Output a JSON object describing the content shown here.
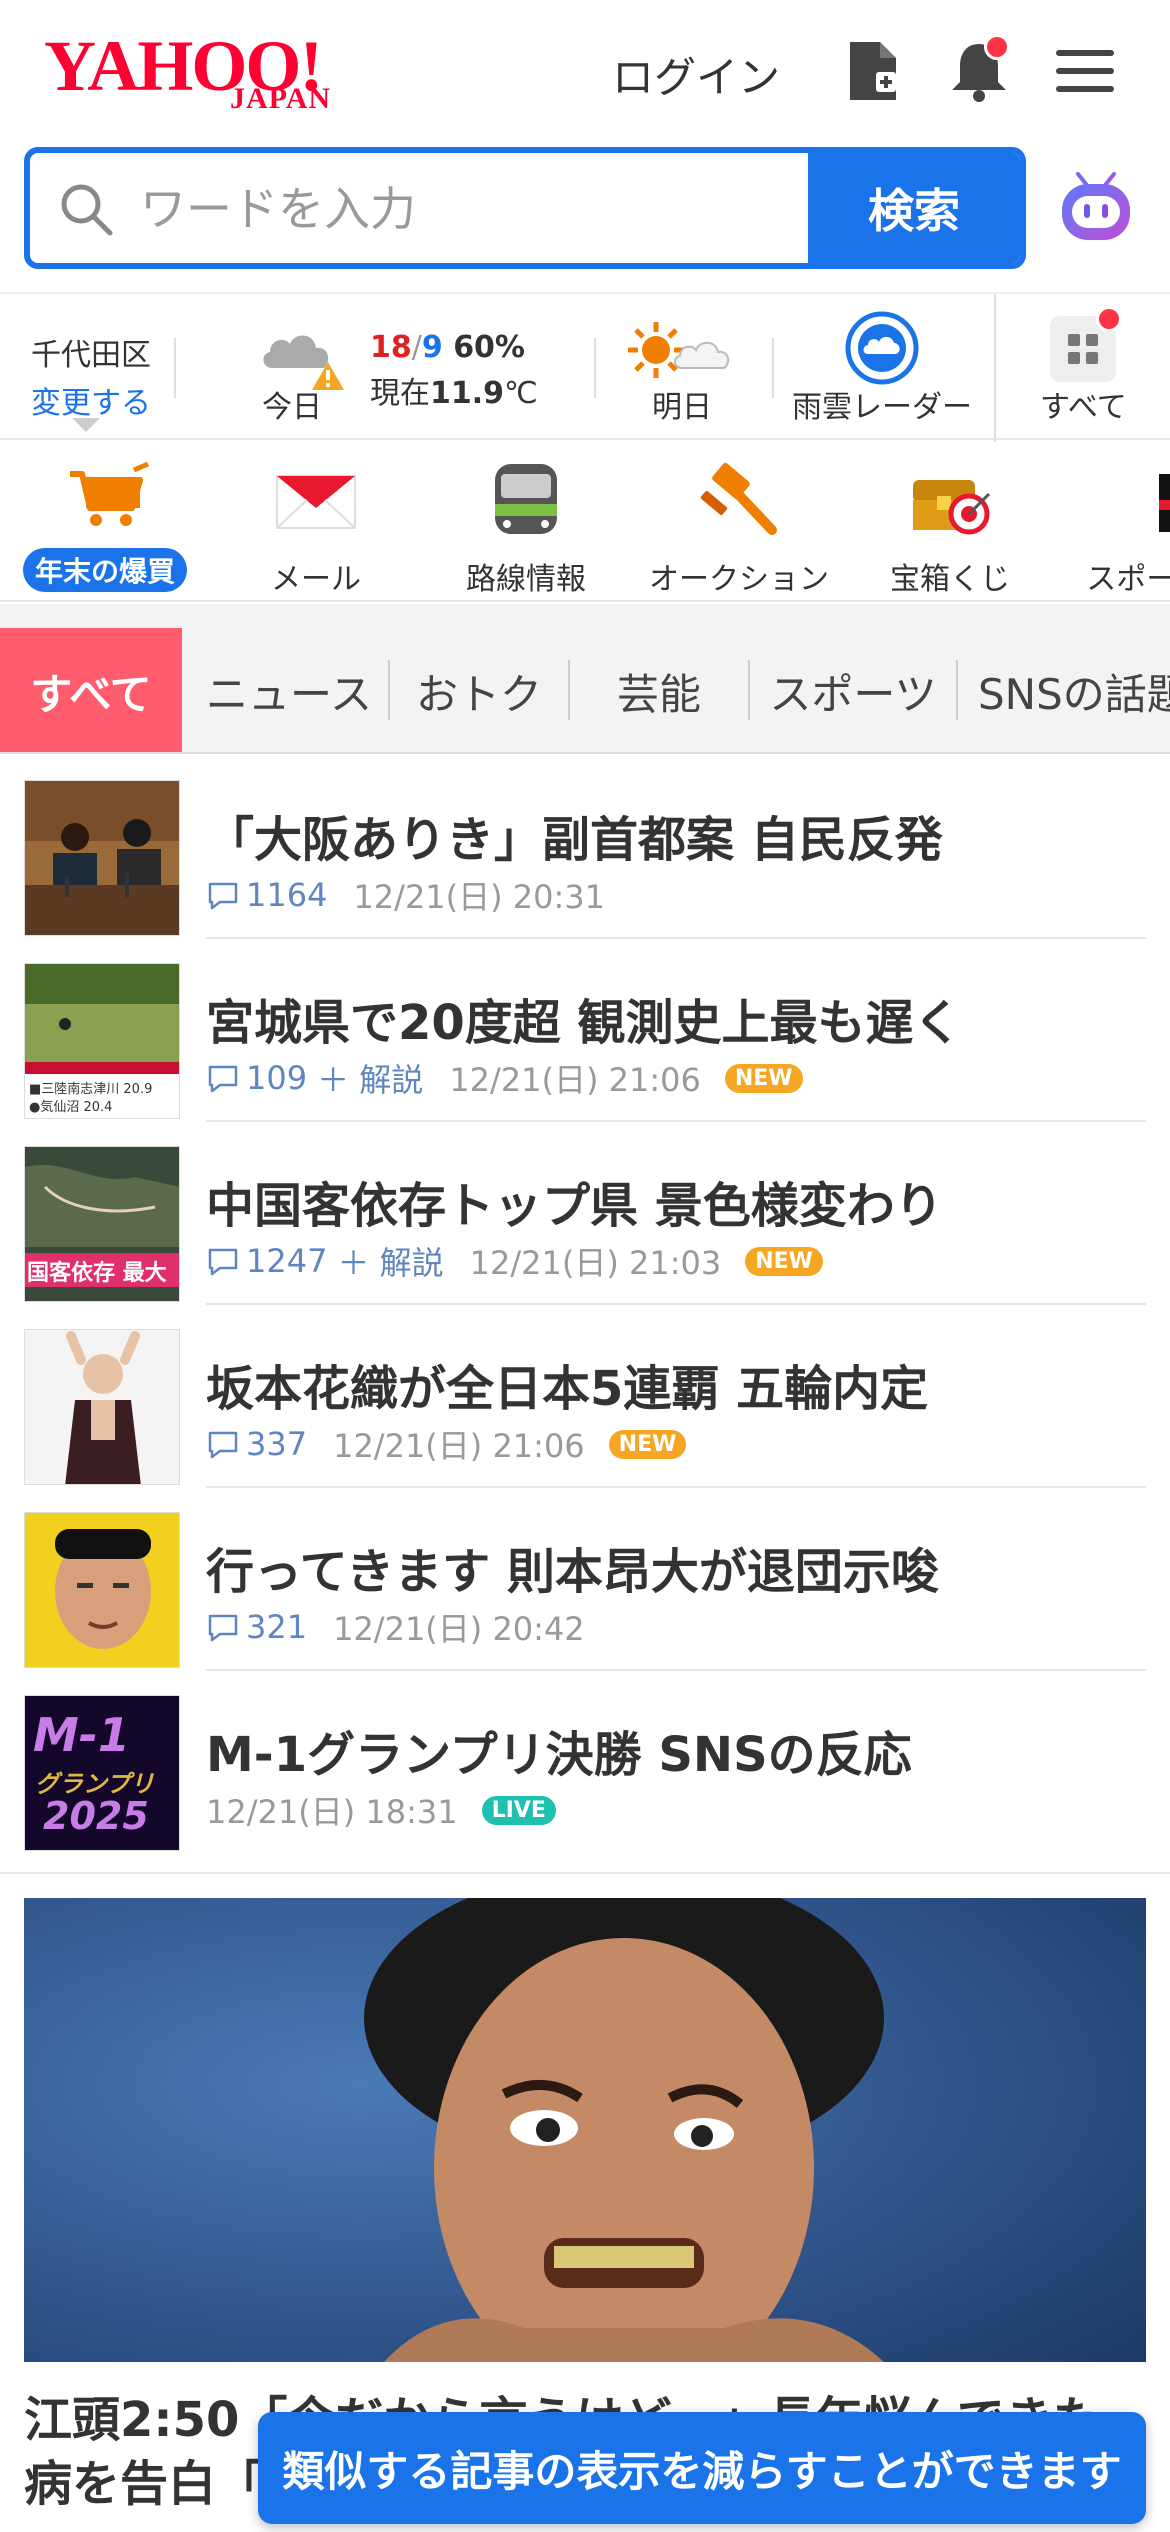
{
  "header": {
    "logo_main": "YAHOO!",
    "logo_sub": "JAPAN",
    "login_label": "ログイン"
  },
  "search": {
    "placeholder": "ワードを入力",
    "button_label": "検索"
  },
  "weather": {
    "location": "千代田区",
    "change_label": "変更する",
    "today_label": "今日",
    "high": "18",
    "slash": "/",
    "low": "9",
    "precip": "60%",
    "now_prefix": "現在",
    "now_temp": "11.9",
    "now_unit": "℃",
    "tomorrow_label": "明日",
    "radar_label": "雨雲レーダー",
    "all_label": "すべて"
  },
  "services": [
    {
      "label": "年末の爆買",
      "icon": "cart-icon"
    },
    {
      "label": "メール",
      "icon": "mail-icon"
    },
    {
      "label": "路線情報",
      "icon": "train-icon"
    },
    {
      "label": "オークション",
      "icon": "gavel-icon"
    },
    {
      "label": "宝箱くじ",
      "icon": "treasure-icon"
    },
    {
      "label": "スポーツ",
      "icon": "sports-icon"
    }
  ],
  "tabs": [
    "すべて",
    "ニュース",
    "おトク",
    "芸能",
    "スポーツ",
    "SNSの話題"
  ],
  "news": [
    {
      "title": "「大阪ありき」副首都案 自民反発",
      "count": "1164",
      "kaisetsu": "",
      "time": "12/21(日) 20:31",
      "badge": ""
    },
    {
      "title": "宮城県で20度超 観測史上最も遅く",
      "count": "109",
      "kaisetsu": "＋ 解説",
      "time": "12/21(日) 21:06",
      "badge": "NEW"
    },
    {
      "title": "中国客依存トップ県 景色様変わり",
      "count": "1247",
      "kaisetsu": "＋ 解説",
      "time": "12/21(日) 21:03",
      "badge": "NEW"
    },
    {
      "title": "坂本花織が全日本5連覇 五輪内定",
      "count": "337",
      "kaisetsu": "",
      "time": "12/21(日) 21:06",
      "badge": "NEW"
    },
    {
      "title": "行ってきます 則本昂大が退団示唆",
      "count": "321",
      "kaisetsu": "",
      "time": "12/21(日) 20:42",
      "badge": ""
    },
    {
      "title": "M-1グランプリ決勝 SNSの反応",
      "count": "",
      "kaisetsu": "",
      "time": "12/21(日) 18:31",
      "badge": "LIVE"
    }
  ],
  "thumb_texts": {
    "t2_line1": "■三陸南志津川 20.9",
    "t2_line2": "●気仙沼 20.4",
    "t3": "国客依存 最大",
    "t6_a": "M-1",
    "t6_b": "グランプリ",
    "t6_c": "2025"
  },
  "feature": {
    "title": "江頭2:50「今だから言うけど…」長年悩んできた病を告白「"
  },
  "toast": {
    "text": "類似する記事の表示を減らすことができます"
  },
  "colors": {
    "brand_red": "#ff0033",
    "accent_blue": "#1a73e8",
    "tab_active": "#ff5c6e",
    "new_badge": "#f5a623",
    "live_badge": "#1ec0b0"
  }
}
